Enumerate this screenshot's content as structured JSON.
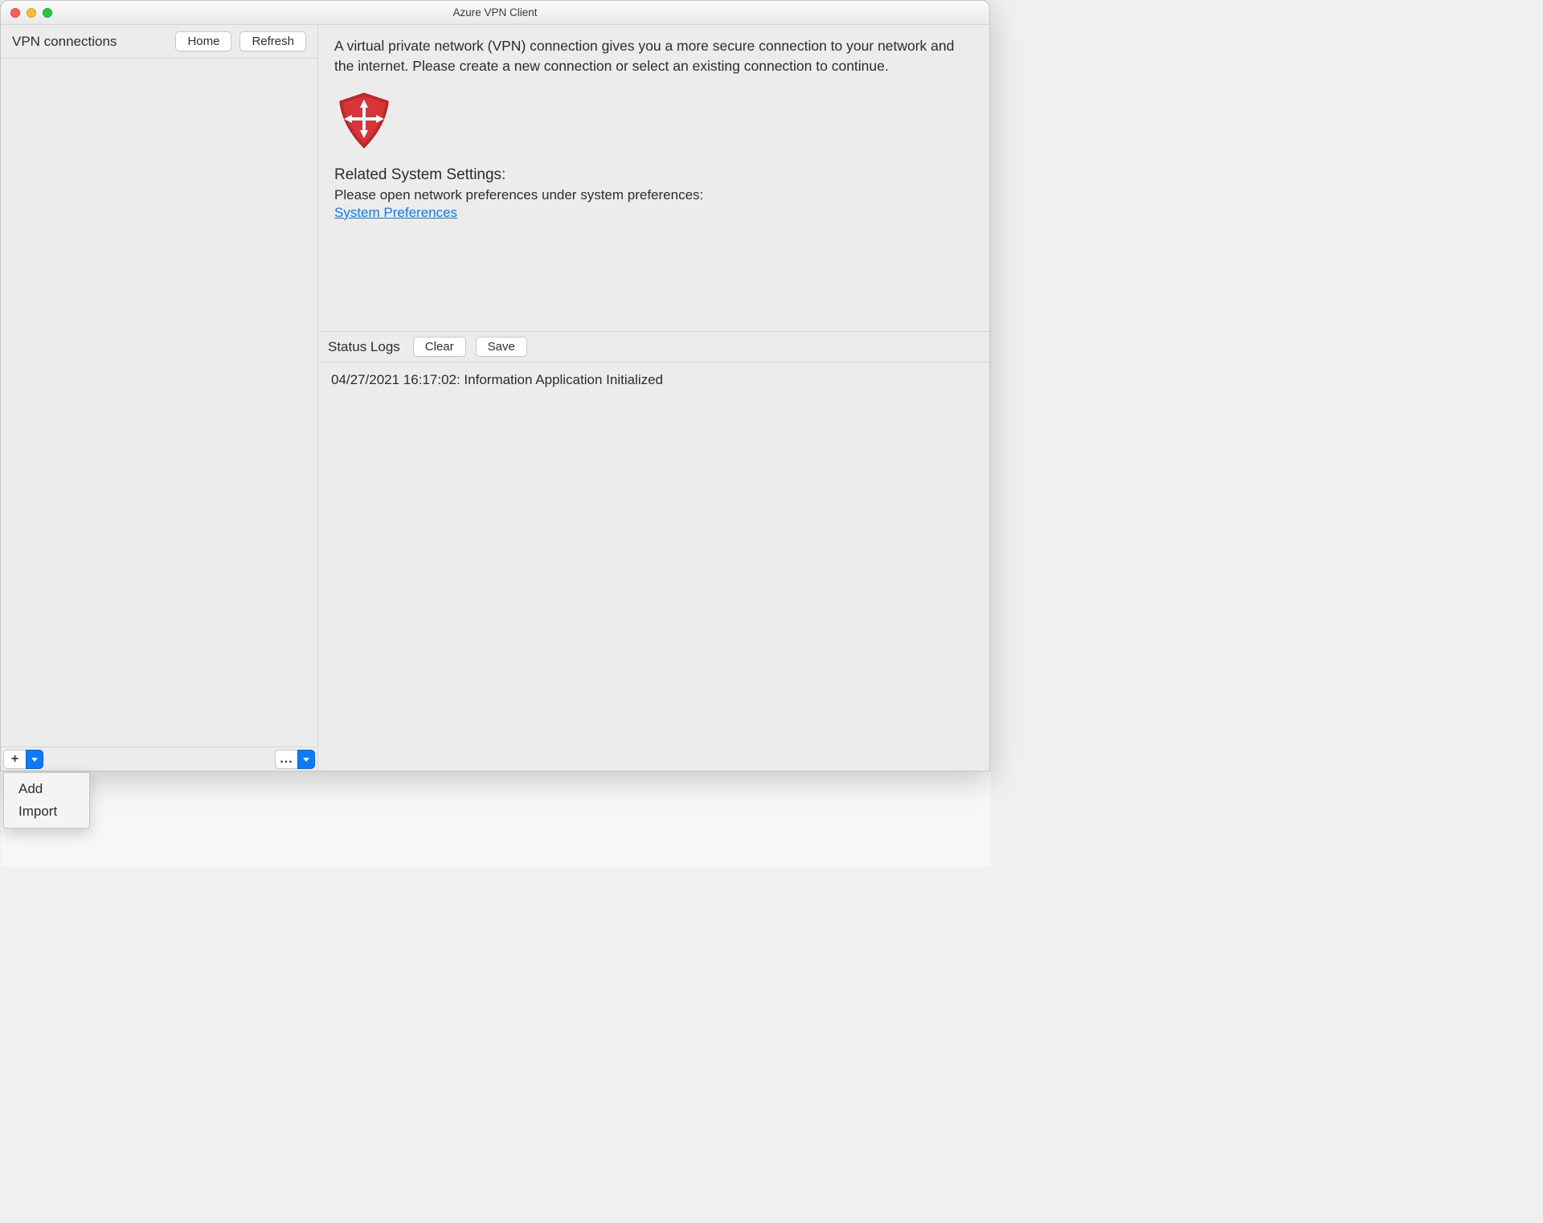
{
  "window": {
    "title": "Azure VPN Client"
  },
  "sidebar": {
    "title": "VPN connections",
    "home_label": "Home",
    "refresh_label": "Refresh",
    "footer": {
      "add_symbol": "+",
      "more_symbol": "..."
    }
  },
  "main": {
    "intro": "A virtual private network (VPN) connection gives you a more secure connection to your network and the internet. Please create a new connection or select an existing connection to continue.",
    "related_heading": "Related System Settings:",
    "related_sub": "Please open network preferences under system preferences:",
    "system_prefs_link": "System Preferences"
  },
  "logs": {
    "label": "Status Logs",
    "clear_label": "Clear",
    "save_label": "Save",
    "entry": "04/27/2021 16:17:02: Information Application Initialized"
  },
  "popup": {
    "add": "Add",
    "import": "Import"
  }
}
